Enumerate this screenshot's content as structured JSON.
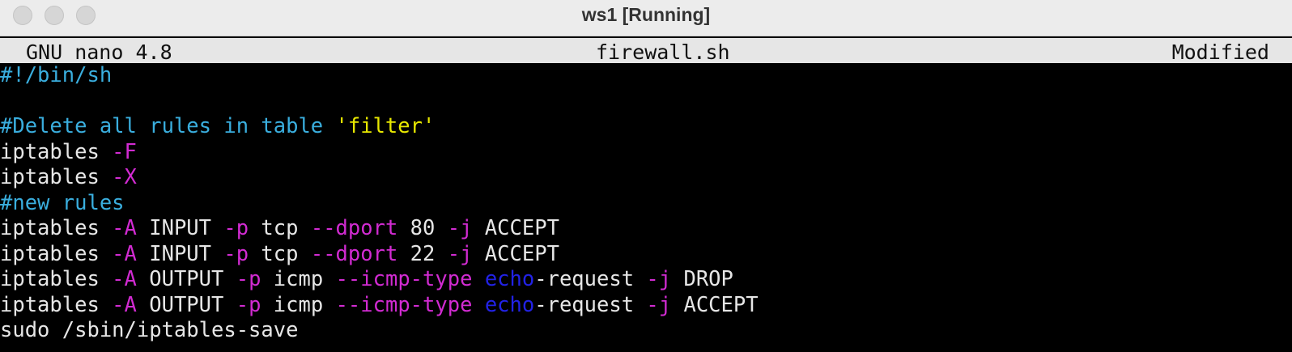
{
  "window": {
    "title": "ws1 [Running]"
  },
  "nano": {
    "version": "GNU nano 4.8",
    "filename": "firewall.sh",
    "status": "Modified"
  },
  "lines": [
    [
      {
        "t": "#!/bin/sh",
        "c": "comment"
      }
    ],
    [],
    [
      {
        "t": "#Delete all rules in table ",
        "c": "comment"
      },
      {
        "t": "'filter'",
        "c": "string"
      }
    ],
    [
      {
        "t": "iptables ",
        "c": "text"
      },
      {
        "t": "-F",
        "c": "flag"
      }
    ],
    [
      {
        "t": "iptables ",
        "c": "text"
      },
      {
        "t": "-X",
        "c": "flag"
      }
    ],
    [
      {
        "t": "#new rules",
        "c": "comment"
      }
    ],
    [
      {
        "t": "iptables ",
        "c": "text"
      },
      {
        "t": "-A",
        "c": "flag"
      },
      {
        "t": " INPUT ",
        "c": "text"
      },
      {
        "t": "-p",
        "c": "flag"
      },
      {
        "t": " tcp ",
        "c": "text"
      },
      {
        "t": "--dport",
        "c": "flag"
      },
      {
        "t": " 80 ",
        "c": "text"
      },
      {
        "t": "-j",
        "c": "flag"
      },
      {
        "t": " ACCEPT",
        "c": "text"
      }
    ],
    [
      {
        "t": "iptables ",
        "c": "text"
      },
      {
        "t": "-A",
        "c": "flag"
      },
      {
        "t": " INPUT ",
        "c": "text"
      },
      {
        "t": "-p",
        "c": "flag"
      },
      {
        "t": " tcp ",
        "c": "text"
      },
      {
        "t": "--dport",
        "c": "flag"
      },
      {
        "t": " 22 ",
        "c": "text"
      },
      {
        "t": "-j",
        "c": "flag"
      },
      {
        "t": " ACCEPT",
        "c": "text"
      }
    ],
    [
      {
        "t": "iptables ",
        "c": "text"
      },
      {
        "t": "-A",
        "c": "flag"
      },
      {
        "t": " OUTPUT ",
        "c": "text"
      },
      {
        "t": "-p",
        "c": "flag"
      },
      {
        "t": " icmp ",
        "c": "text"
      },
      {
        "t": "--icmp-type",
        "c": "flag"
      },
      {
        "t": " ",
        "c": "text"
      },
      {
        "t": "echo",
        "c": "blue"
      },
      {
        "t": "-request ",
        "c": "text"
      },
      {
        "t": "-j",
        "c": "flag"
      },
      {
        "t": " DROP",
        "c": "text"
      }
    ],
    [
      {
        "t": "iptables ",
        "c": "text"
      },
      {
        "t": "-A",
        "c": "flag"
      },
      {
        "t": " OUTPUT ",
        "c": "text"
      },
      {
        "t": "-p",
        "c": "flag"
      },
      {
        "t": " icmp ",
        "c": "text"
      },
      {
        "t": "--icmp-type",
        "c": "flag"
      },
      {
        "t": " ",
        "c": "text"
      },
      {
        "t": "echo",
        "c": "blue"
      },
      {
        "t": "-request ",
        "c": "text"
      },
      {
        "t": "-j",
        "c": "flag"
      },
      {
        "t": " ACCEPT",
        "c": "text"
      }
    ],
    [
      {
        "t": "sudo /sbin/iptables-save",
        "c": "text"
      }
    ]
  ],
  "colors": {
    "comment": "#3aaede",
    "string": "#e8e800",
    "flag": "#d22bd2",
    "blue": "#2222e6",
    "text": "#e6e6e6"
  }
}
